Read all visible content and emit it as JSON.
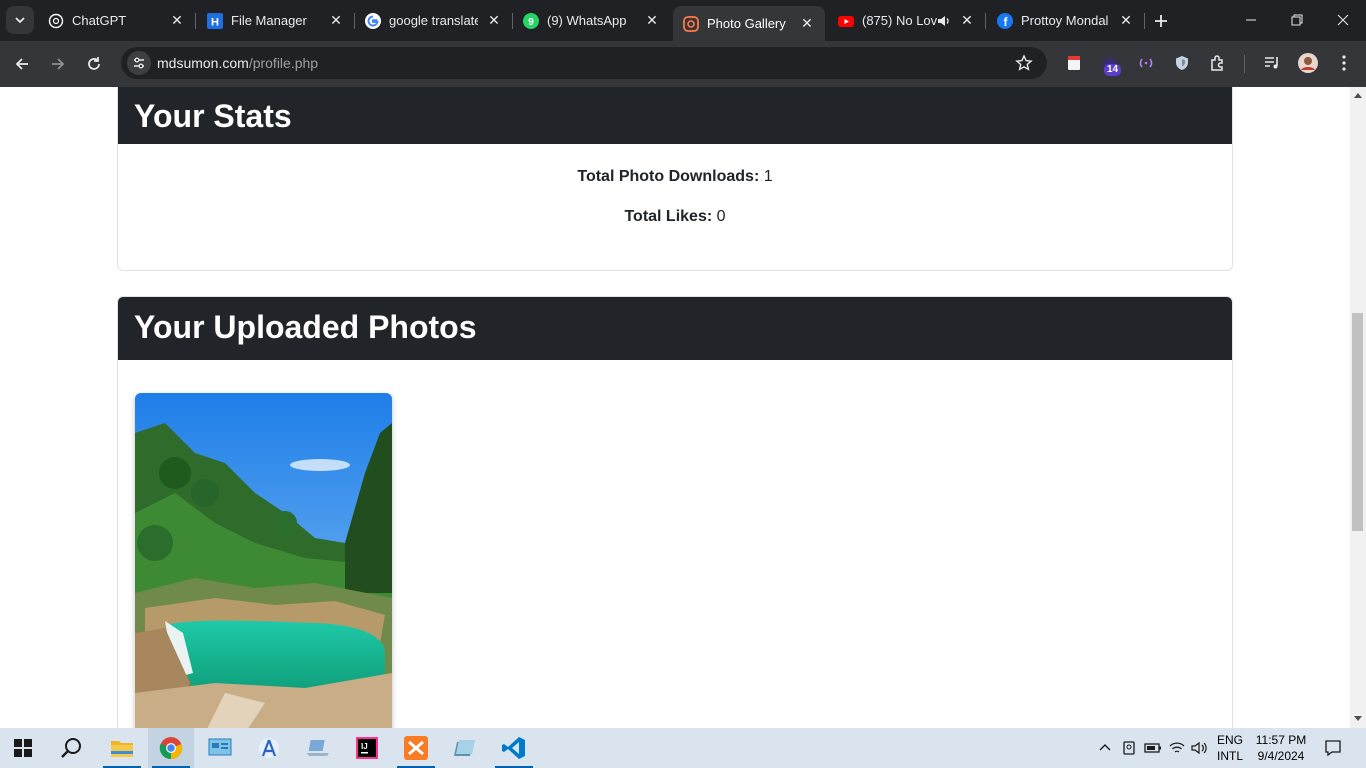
{
  "browser": {
    "tabs": [
      {
        "title": "ChatGPT",
        "icon": "chatgpt-icon"
      },
      {
        "title": "File Manager",
        "icon": "file-manager-icon"
      },
      {
        "title": "google translate",
        "icon": "google-icon"
      },
      {
        "title": "(9) WhatsApp",
        "icon": "whatsapp-icon"
      },
      {
        "title": "Photo Gallery",
        "icon": "photo-gallery-icon",
        "active": true
      },
      {
        "title": "(875) No Lov",
        "icon": "youtube-icon",
        "audio": true
      },
      {
        "title": "Prottoy Mondal",
        "icon": "facebook-icon"
      }
    ],
    "address": {
      "domain": "mdsumon.com",
      "path": "/profile.php"
    },
    "extension_badge": "14"
  },
  "page": {
    "stats": {
      "title": "Your Stats",
      "downloads_label": "Total Photo Downloads:",
      "downloads_value": "1",
      "likes_label": "Total Likes:",
      "likes_value": "0"
    },
    "photos": {
      "title": "Your Uploaded Photos",
      "items": [
        {
          "subject": "waterfall-lake-photo"
        }
      ]
    }
  },
  "taskbar": {
    "lang_top": "ENG",
    "lang_bottom": "INTL",
    "time": "11:57 PM",
    "date": "9/4/2024"
  },
  "colors": {
    "tabbar": "#202124",
    "toolbar": "#35363a",
    "card_header": "#212529",
    "taskbar": "#d9e4ee"
  }
}
